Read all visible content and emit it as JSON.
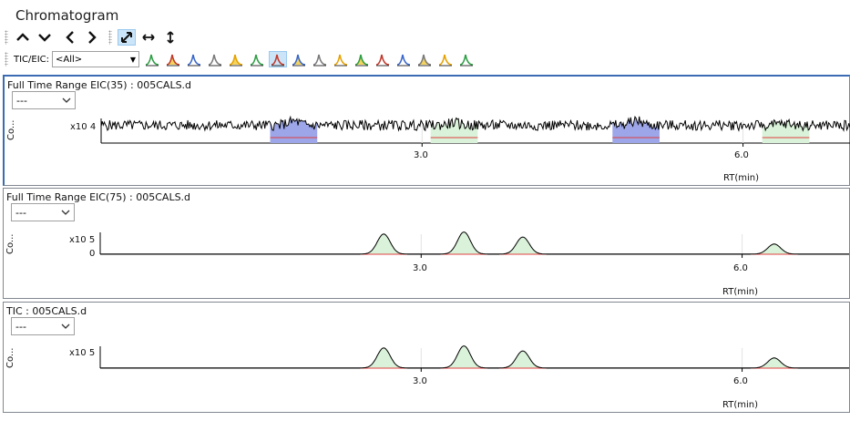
{
  "window": {
    "title": "Chromatogram"
  },
  "toolbar": {
    "nav_buttons": [
      {
        "name": "chevron-up-icon",
        "glyph": "⌃"
      },
      {
        "name": "chevron-down-icon",
        "glyph": "⌄"
      },
      {
        "name": "chevron-left-icon",
        "glyph": "‹"
      },
      {
        "name": "chevron-right-icon",
        "glyph": "›"
      }
    ],
    "zoom_buttons": [
      {
        "name": "autoscale-both-icon",
        "glyph": "⤡",
        "selected": true
      },
      {
        "name": "autoscale-x-icon",
        "glyph": "↔",
        "selected": false
      },
      {
        "name": "autoscale-y-icon",
        "glyph": "↕",
        "selected": false
      }
    ],
    "tic_eic_label": "TIC/EIC:",
    "tic_eic_value": "<All>",
    "icons": [
      "integrate-icon",
      "peak-table-icon",
      "overlay-icon",
      "smooth-icon",
      "subtract-icon",
      "mark-peak-icon",
      "peak-area-icon",
      "peak-select-icon",
      "peak-label-icon",
      "baseline-icon",
      "split-peak-icon",
      "export-icon",
      "add-peak-icon",
      "delete-peak-icon",
      "spectrum-icon",
      "report-icon"
    ],
    "selected_icon": 6
  },
  "panes": [
    {
      "title": "Full Time Range EIC(35) : 005CALS.d",
      "select_value": "---",
      "y_label": "Co...",
      "scale": "x10 4",
      "zero_label": "",
      "x_ticks": [
        "3.0",
        "6.0"
      ],
      "x_label": "RT(min)",
      "active": true
    },
    {
      "title": "Full Time Range EIC(75) : 005CALS.d",
      "select_value": "---",
      "y_label": "Co...",
      "scale": "x10 5",
      "zero_label": "0",
      "x_ticks": [
        "3.0",
        "6.0"
      ],
      "x_label": "RT(min)",
      "active": false
    },
    {
      "title": "TIC : 005CALS.d",
      "select_value": "---",
      "y_label": "Co...",
      "scale": "x10 5",
      "zero_label": "",
      "x_ticks": [
        "3.0",
        "6.0"
      ],
      "x_label": "RT(min)",
      "active": false
    }
  ],
  "chart_data": [
    {
      "type": "line",
      "series": [
        {
          "values_note_free": true,
          "peaks": [
            {
              "rt": 1.8,
              "height": 0.5
            },
            {
              "rt": 3.3,
              "height": 0.3
            },
            {
              "rt": 5.0,
              "height": 0.6
            },
            {
              "rt": 6.4,
              "height": 0.2
            }
          ]
        }
      ],
      "x_ticks": [
        3.0,
        6.0
      ],
      "xlim": [
        0.0,
        7.0
      ],
      "noise": true
    },
    {
      "type": "line",
      "series": [
        {
          "peaks": [
            {
              "rt": 2.65,
              "height": 1.0
            },
            {
              "rt": 3.4,
              "height": 1.1
            },
            {
              "rt": 3.95,
              "height": 0.85
            },
            {
              "rt": 6.3,
              "height": 0.5
            }
          ]
        }
      ],
      "x_ticks": [
        3.0,
        6.0
      ],
      "xlim": [
        0.0,
        7.0
      ],
      "noise": false
    },
    {
      "type": "line",
      "series": [
        {
          "peaks": [
            {
              "rt": 2.65,
              "height": 1.0
            },
            {
              "rt": 3.4,
              "height": 1.1
            },
            {
              "rt": 3.95,
              "height": 0.85
            },
            {
              "rt": 6.3,
              "height": 0.5
            }
          ]
        }
      ],
      "x_ticks": [
        3.0,
        6.0
      ],
      "xlim": [
        0.0,
        7.0
      ],
      "noise": false
    }
  ],
  "colors": {
    "peak_fill": "#d9f2d9",
    "peak_fill_blue": "#9ca6e8",
    "baseline_red": "#e04040",
    "trace": "#000000",
    "active_border": "#3b6cb3"
  }
}
